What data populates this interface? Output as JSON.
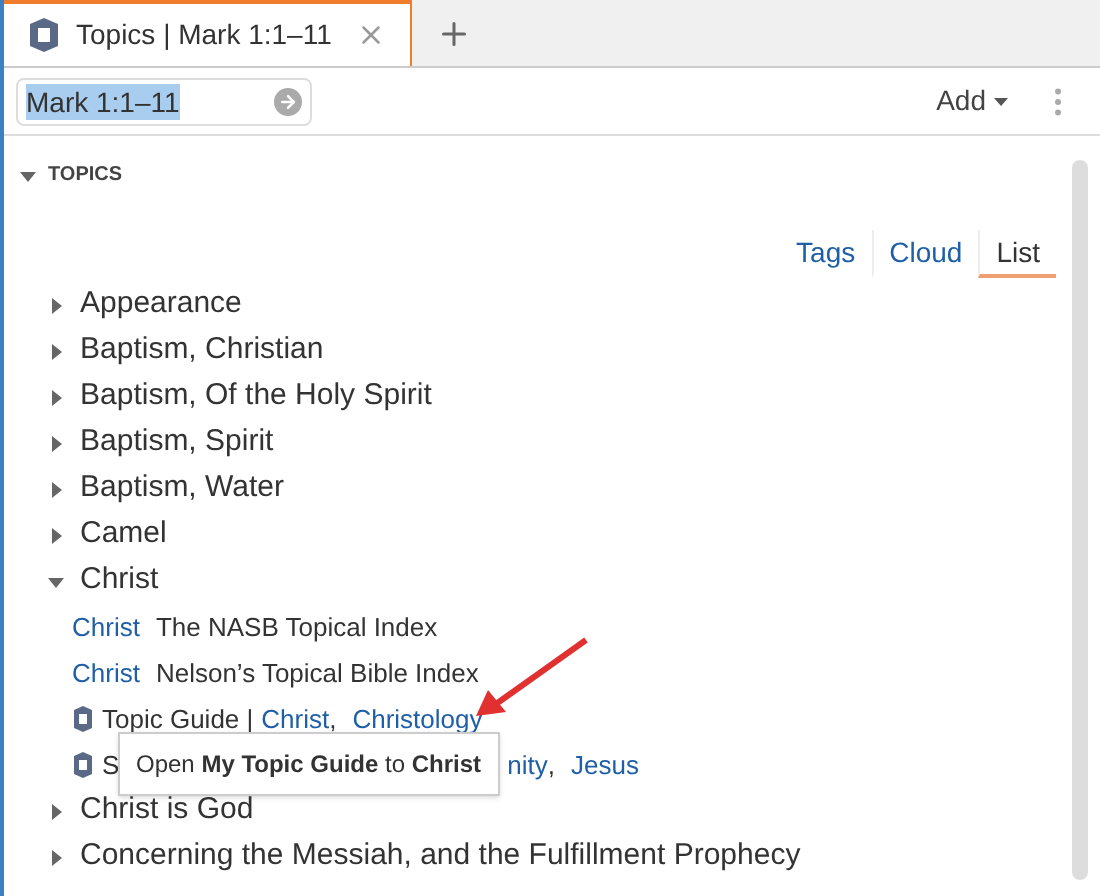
{
  "tab": {
    "title": "Topics | Mark 1:1–11"
  },
  "reference_field": {
    "value": "Mark 1:1–11"
  },
  "add_button": {
    "label": "Add"
  },
  "section": {
    "title": "TOPICS",
    "expanded": true
  },
  "view_tabs": [
    {
      "label": "Tags",
      "selected": false
    },
    {
      "label": "Cloud",
      "selected": false
    },
    {
      "label": "List",
      "selected": true
    }
  ],
  "topics": [
    {
      "label": "Appearance",
      "expanded": false
    },
    {
      "label": "Baptism, Christian",
      "expanded": false
    },
    {
      "label": "Baptism, Of the Holy Spirit",
      "expanded": false
    },
    {
      "label": "Baptism, Spirit",
      "expanded": false
    },
    {
      "label": "Baptism, Water",
      "expanded": false
    },
    {
      "label": "Camel",
      "expanded": false
    },
    {
      "label": "Christ",
      "expanded": true,
      "children": [
        {
          "kind": "index",
          "link": "Christ",
          "source": "The NASB Topical Index"
        },
        {
          "kind": "index",
          "link": "Christ",
          "source": "Nelson’s Topical Bible Index"
        },
        {
          "kind": "guide",
          "prefix": "Topic Guide |",
          "links": [
            "Christ",
            "Christology"
          ],
          "separator": ",",
          "covered": false
        },
        {
          "kind": "guide",
          "prefix": "S",
          "links": [
            "nity",
            "Jesus"
          ],
          "separator": ",",
          "covered": true
        }
      ]
    },
    {
      "label": "Christ is God",
      "expanded": false
    },
    {
      "label": "Concerning the Messiah, and the Fulfillment Prophecy",
      "expanded": false
    }
  ],
  "tooltip": {
    "text": "Open **My Topic Guide** to **Christ**"
  }
}
